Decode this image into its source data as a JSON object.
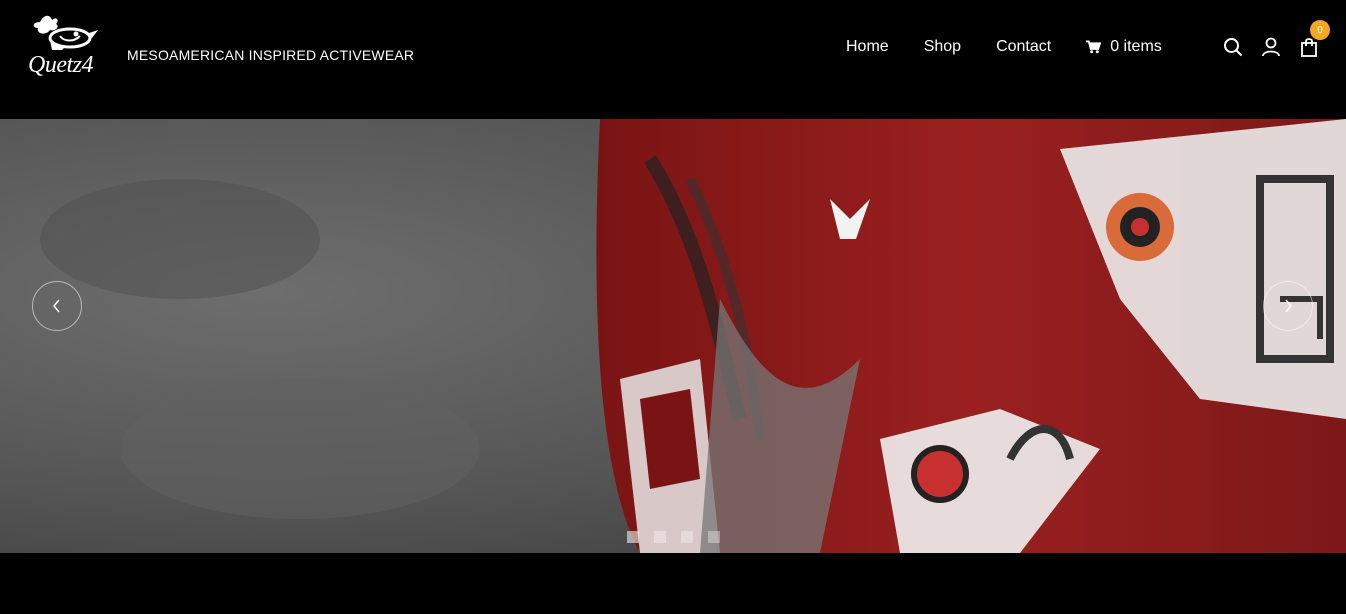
{
  "brand": {
    "logo_text": "Quetz4",
    "tagline": "MESOAMERICAN INSPIRED ACTIVEWEAR"
  },
  "nav": {
    "home": "Home",
    "shop": "Shop",
    "contact": "Contact",
    "cart": "0 items"
  },
  "header_icons": {
    "search": "search-icon",
    "account": "user-icon",
    "bag": "shopping-bag-icon",
    "bag_count": "0"
  },
  "slider": {
    "prev": "chevron-left-icon",
    "next": "chevron-right-icon",
    "slide_count": 4,
    "active_slide": 1
  },
  "colors": {
    "badge": "#f5a623",
    "background": "#000000",
    "jersey_red": "#8e1c1c"
  }
}
